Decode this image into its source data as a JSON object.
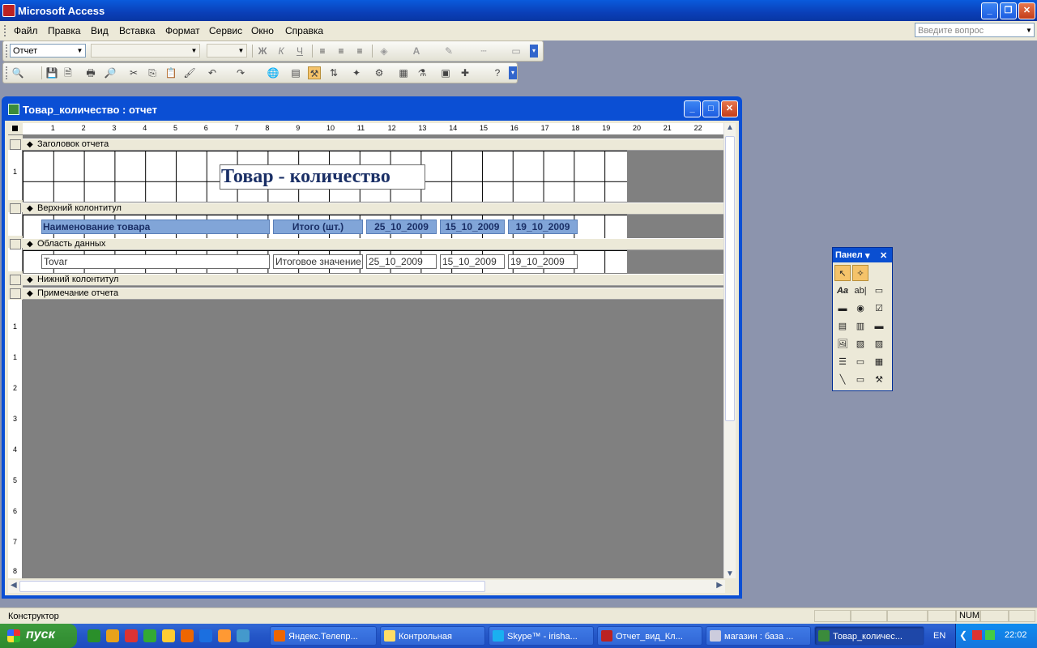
{
  "app": {
    "title": "Microsoft Access"
  },
  "menu": {
    "items": [
      "Файл",
      "Правка",
      "Вид",
      "Вставка",
      "Формат",
      "Сервис",
      "Окно",
      "Справка"
    ],
    "ask_placeholder": "Введите вопрос"
  },
  "toolbar": {
    "object_combo": "Отчет",
    "bold_label": "Ж",
    "italic_label": "К",
    "underline_label": "Ч"
  },
  "report_window": {
    "title": "Товар_количество : отчет",
    "sections": {
      "report_header": "Заголовок отчета",
      "page_header": "Верхний колонтитул",
      "detail": "Область данных",
      "page_footer": "Нижний колонтитул",
      "report_footer": "Примечание отчета"
    },
    "report_title": "Товар - количество",
    "header_labels": [
      "Наименование товара",
      "Итого (шт.)",
      "25_10_2009",
      "15_10_2009",
      "19_10_2009"
    ],
    "detail_fields": [
      "Tovar",
      "Итоговое значение",
      "25_10_2009",
      "15_10_2009",
      "19_10_2009"
    ],
    "ruler_numbers": [
      "1",
      "2",
      "3",
      "4",
      "5",
      "6",
      "7",
      "8",
      "9",
      "10",
      "11",
      "12",
      "13",
      "14",
      "15",
      "16",
      "17",
      "18",
      "19",
      "20",
      "21",
      "22"
    ],
    "vruler_numbers": [
      "1",
      "1",
      "1",
      "2",
      "3",
      "4",
      "5",
      "6",
      "7",
      "8"
    ]
  },
  "toolbox": {
    "title": "Панел"
  },
  "status": {
    "mode": "Конструктор",
    "num": "NUM"
  },
  "taskbar": {
    "start_label": "пуск",
    "tasks": [
      "Яндекс.Телепр...",
      "Контрольная",
      "Skype™ - irisha...",
      "Отчет_вид_Кл...",
      "магазин : база ...",
      "Товар_количес..."
    ],
    "lang": "EN",
    "clock": "22:02"
  }
}
